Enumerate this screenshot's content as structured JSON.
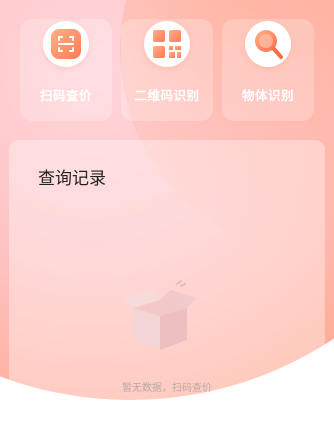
{
  "features": [
    {
      "label": "扫码查价",
      "icon": "scan-icon"
    },
    {
      "label": "二维码识别",
      "icon": "qrcode-icon"
    },
    {
      "label": "物体识别",
      "icon": "magnifier-icon"
    }
  ],
  "history": {
    "title": "查询记录",
    "empty_text": "暂无数据，扫码查价",
    "empty_icon": "empty-box-icon"
  },
  "colors": {
    "accent": "#ff9a6e",
    "pink": "#ffc3c4"
  }
}
